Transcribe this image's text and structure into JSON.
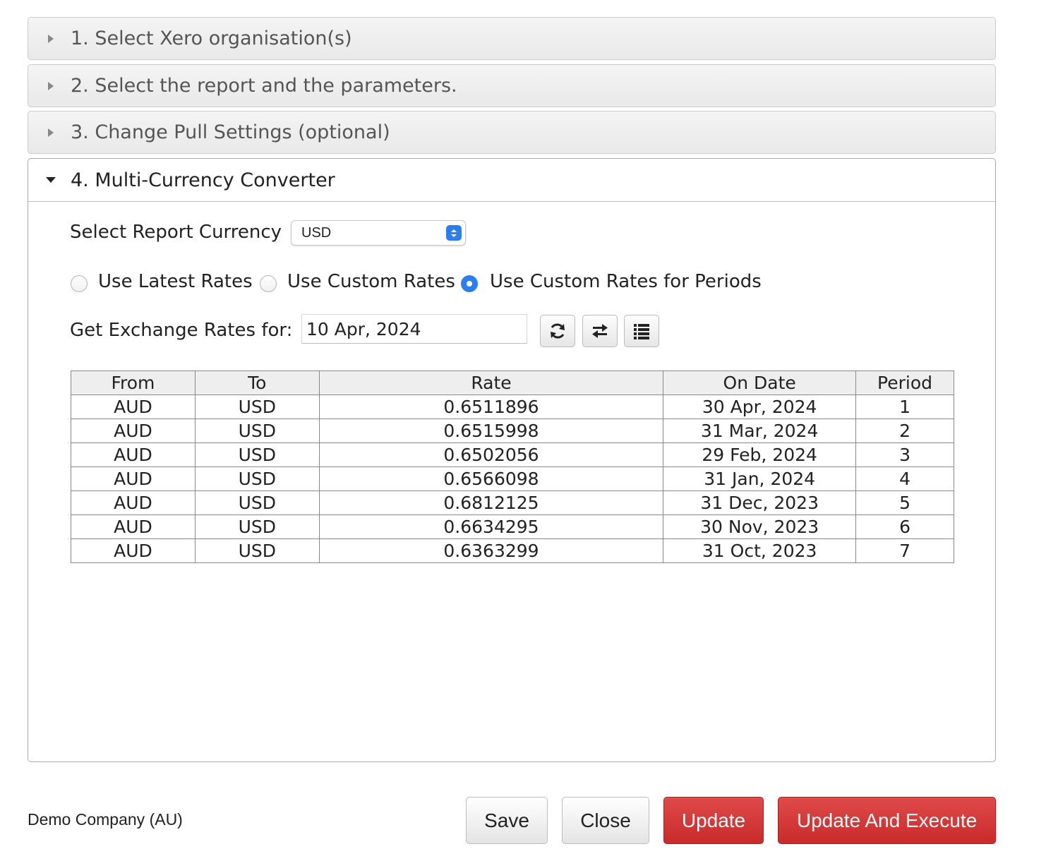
{
  "accordion": {
    "sections": [
      {
        "label": "1. Select Xero organisation(s)",
        "expanded": false
      },
      {
        "label": "2. Select the report and the parameters.",
        "expanded": false
      },
      {
        "label": "3. Change Pull Settings (optional)",
        "expanded": false
      },
      {
        "label": "4. Multi-Currency Converter",
        "expanded": true
      }
    ]
  },
  "converter": {
    "currency_label": "Select Report Currency",
    "currency_value": "USD",
    "rate_options": [
      {
        "label": "Use Latest Rates",
        "checked": false
      },
      {
        "label": "Use Custom Rates",
        "checked": false
      },
      {
        "label": "Use Custom Rates for Periods",
        "checked": true
      }
    ],
    "date_label": "Get Exchange Rates for:",
    "date_value": "10 Apr, 2024",
    "toolbar_icons": [
      "refresh-icon",
      "swap-icon",
      "list-icon"
    ]
  },
  "table": {
    "headers": [
      "From",
      "To",
      "Rate",
      "On Date",
      "Period"
    ],
    "rows": [
      [
        "AUD",
        "USD",
        "0.6511896",
        "30 Apr, 2024",
        "1"
      ],
      [
        "AUD",
        "USD",
        "0.6515998",
        "31 Mar, 2024",
        "2"
      ],
      [
        "AUD",
        "USD",
        "0.6502056",
        "29 Feb, 2024",
        "3"
      ],
      [
        "AUD",
        "USD",
        "0.6566098",
        "31 Jan, 2024",
        "4"
      ],
      [
        "AUD",
        "USD",
        "0.6812125",
        "31 Dec, 2023",
        "5"
      ],
      [
        "AUD",
        "USD",
        "0.6634295",
        "30 Nov, 2023",
        "6"
      ],
      [
        "AUD",
        "USD",
        "0.6363299",
        "31 Oct, 2023",
        "7"
      ]
    ]
  },
  "footer": {
    "company": "Demo Company (AU)",
    "save_label": "Save",
    "close_label": "Close",
    "update_label": "Update",
    "update_execute_label": "Update And Execute"
  },
  "colors": {
    "accent_blue": "#2a7ef0",
    "button_red": "#d03535"
  }
}
